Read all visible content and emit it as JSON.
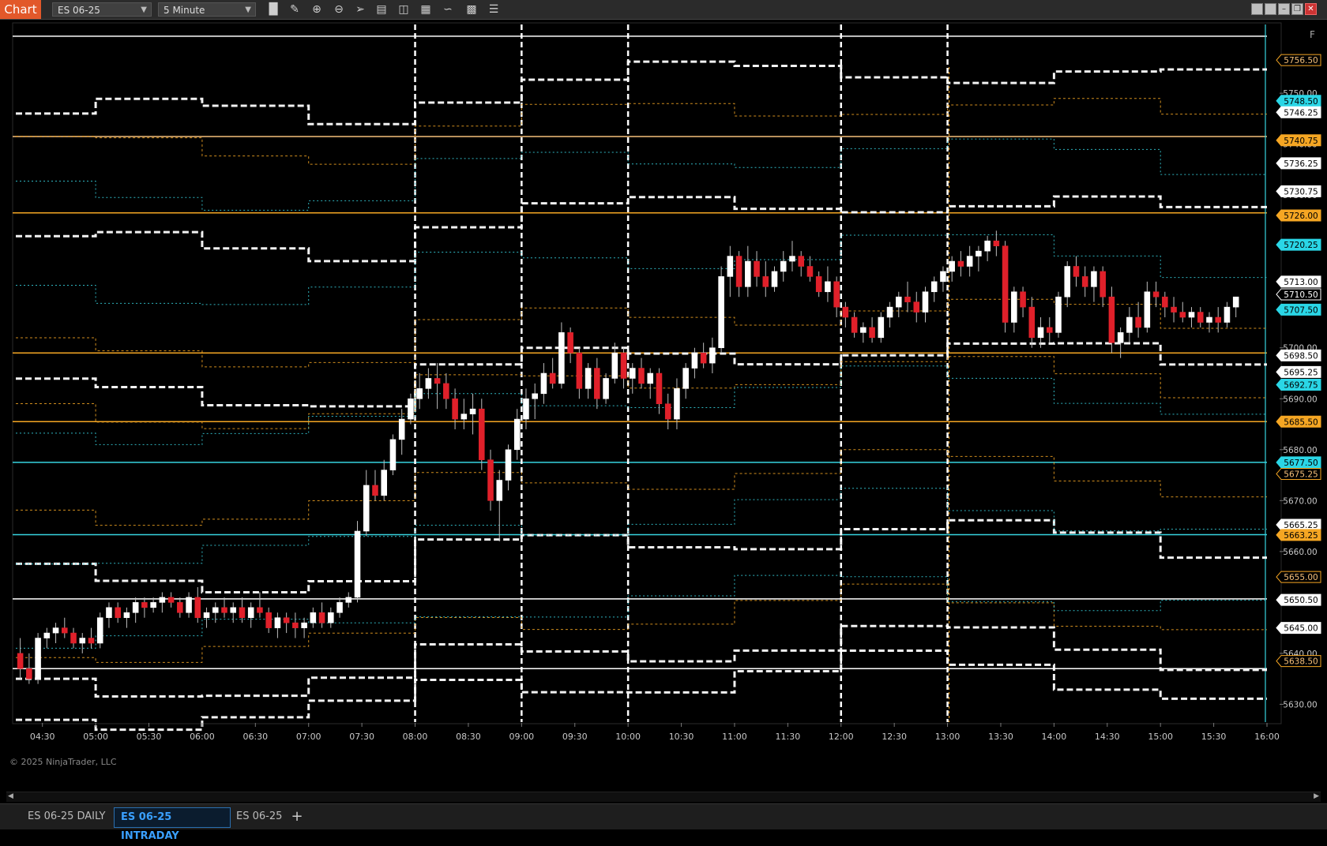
{
  "app": {
    "window_label": "Chart"
  },
  "toolbar": {
    "instrument": "ES 06-25",
    "interval": "5 Minute",
    "icons": [
      "bar-type-icon",
      "draw-tool-icon",
      "zoom-in-icon",
      "zoom-out-icon",
      "pointer-icon",
      "data-box-icon",
      "indicators-icon",
      "strategies-icon",
      "chart-trader-icon",
      "properties-icon",
      "list-icon"
    ]
  },
  "window_controls": [
    "tile-icon",
    "tile-icon",
    "minimize-icon",
    "restore-icon",
    "close-icon"
  ],
  "chart_data": {
    "type": "candlestick",
    "x_ticks": [
      "04:30",
      "05:00",
      "05:30",
      "06:00",
      "06:30",
      "07:00",
      "07:30",
      "08:00",
      "08:30",
      "09:00",
      "09:30",
      "10:00",
      "10:30",
      "11:00",
      "11:30",
      "12:00",
      "12:30",
      "13:00",
      "13:30",
      "14:00",
      "14:30",
      "15:00",
      "15:30",
      "16:00"
    ],
    "y_ticks": [
      5750,
      5740,
      5730,
      5720,
      5710,
      5700,
      5690,
      5680,
      5670,
      5660,
      5650,
      5640,
      5630
    ],
    "y_tick_labels": [
      "5750.00",
      "5740.00",
      "5730.00",
      "5720.00",
      "5710.00",
      "5700.00",
      "5690.00",
      "5680.00",
      "5670.00",
      "5660.00",
      "5650.00",
      "5640.00",
      "5630.00"
    ],
    "ylim": [
      5626.5,
      5763.5
    ],
    "x_start": "04:15",
    "bar_minutes": 5,
    "price_markers": [
      {
        "label": "5756.50",
        "value": 5756.5,
        "kind": "orange-outline"
      },
      {
        "label": "5748.50",
        "value": 5748.5,
        "kind": "cyan"
      },
      {
        "label": "5746.25",
        "value": 5746.25,
        "kind": "white"
      },
      {
        "label": "5740.75",
        "value": 5740.75,
        "kind": "orange"
      },
      {
        "label": "5736.25",
        "value": 5736.25,
        "kind": "white"
      },
      {
        "label": "5730.75",
        "value": 5730.75,
        "kind": "white"
      },
      {
        "label": "5726.00",
        "value": 5726.0,
        "kind": "orange"
      },
      {
        "label": "5720.25",
        "value": 5720.25,
        "kind": "cyan"
      },
      {
        "label": "5713.00",
        "value": 5713.0,
        "kind": "white"
      },
      {
        "label": "5710.50",
        "value": 5710.5,
        "kind": "last"
      },
      {
        "label": "5707.50",
        "value": 5707.5,
        "kind": "cyan"
      },
      {
        "label": "5698.50",
        "value": 5698.5,
        "kind": "white"
      },
      {
        "label": "5695.25",
        "value": 5695.25,
        "kind": "white"
      },
      {
        "label": "5692.75",
        "value": 5692.75,
        "kind": "cyan"
      },
      {
        "label": "5685.50",
        "value": 5685.5,
        "kind": "orange"
      },
      {
        "label": "5677.50",
        "value": 5677.5,
        "kind": "cyan"
      },
      {
        "label": "5675.25",
        "value": 5675.25,
        "kind": "orange-outline"
      },
      {
        "label": "5665.25",
        "value": 5665.25,
        "kind": "white"
      },
      {
        "label": "5663.25",
        "value": 5663.25,
        "kind": "orange"
      },
      {
        "label": "5655.00",
        "value": 5655.0,
        "kind": "orange-outline"
      },
      {
        "label": "5650.50",
        "value": 5650.5,
        "kind": "white"
      },
      {
        "label": "5645.00",
        "value": 5645.0,
        "kind": "white"
      },
      {
        "label": "5638.50",
        "value": 5638.5,
        "kind": "orange-outline"
      }
    ],
    "horizontal_levels": [
      {
        "value": 5741.5,
        "color": "#f5c07a"
      },
      {
        "value": 5726.5,
        "color": "#f5a623"
      },
      {
        "value": 5699.0,
        "color": "#f5a623"
      },
      {
        "value": 5685.5,
        "color": "#f5a623"
      },
      {
        "value": 5677.5,
        "color": "#37d4e0"
      },
      {
        "value": 5663.3,
        "color": "#37d4e0"
      },
      {
        "value": 5650.7,
        "color": "#ffffff"
      },
      {
        "value": 5637.0,
        "color": "#ffffff"
      },
      {
        "value": 5761.2,
        "color": "#ffffff"
      }
    ],
    "candles": [
      [
        5640,
        5643,
        5635,
        5637
      ],
      [
        5637,
        5640,
        5634,
        5635
      ],
      [
        5635,
        5644,
        5634,
        5643
      ],
      [
        5643,
        5645,
        5641,
        5644
      ],
      [
        5644,
        5646,
        5642,
        5645
      ],
      [
        5645,
        5647,
        5643,
        5644
      ],
      [
        5644,
        5645,
        5641,
        5642
      ],
      [
        5642,
        5644,
        5640,
        5643
      ],
      [
        5643,
        5645,
        5641,
        5642
      ],
      [
        5642,
        5648,
        5641,
        5647
      ],
      [
        5647,
        5650,
        5645,
        5649
      ],
      [
        5649,
        5650,
        5646,
        5647
      ],
      [
        5647,
        5649,
        5645,
        5648
      ],
      [
        5648,
        5651,
        5646,
        5650
      ],
      [
        5650,
        5651,
        5647,
        5649
      ],
      [
        5649,
        5651,
        5648,
        5650
      ],
      [
        5650,
        5652,
        5648,
        5651
      ],
      [
        5651,
        5652,
        5649,
        5650
      ],
      [
        5650,
        5651,
        5647,
        5648
      ],
      [
        5648,
        5652,
        5647,
        5651
      ],
      [
        5651,
        5653,
        5646,
        5647
      ],
      [
        5647,
        5649,
        5645,
        5648
      ],
      [
        5648,
        5650,
        5646,
        5649
      ],
      [
        5649,
        5651,
        5647,
        5648
      ],
      [
        5648,
        5650,
        5646,
        5649
      ],
      [
        5649,
        5651,
        5646,
        5647
      ],
      [
        5647,
        5650,
        5645,
        5649
      ],
      [
        5649,
        5652,
        5647,
        5648
      ],
      [
        5648,
        5649,
        5644,
        5645
      ],
      [
        5645,
        5648,
        5643,
        5647
      ],
      [
        5647,
        5648,
        5644,
        5646
      ],
      [
        5646,
        5648,
        5643,
        5645
      ],
      [
        5645,
        5647,
        5643,
        5646
      ],
      [
        5646,
        5649,
        5645,
        5648
      ],
      [
        5648,
        5650,
        5645,
        5646
      ],
      [
        5646,
        5649,
        5645,
        5648
      ],
      [
        5648,
        5651,
        5647,
        5650
      ],
      [
        5650,
        5652,
        5649,
        5651
      ],
      [
        5651,
        5666,
        5650,
        5664
      ],
      [
        5664,
        5676,
        5663,
        5673
      ],
      [
        5673,
        5676,
        5670,
        5671
      ],
      [
        5671,
        5678,
        5670,
        5676
      ],
      [
        5676,
        5683,
        5675,
        5682
      ],
      [
        5682,
        5688,
        5679,
        5686
      ],
      [
        5686,
        5691,
        5685,
        5690
      ],
      [
        5690,
        5695,
        5688,
        5692
      ],
      [
        5692,
        5696,
        5690,
        5694
      ],
      [
        5694,
        5697,
        5688,
        5693
      ],
      [
        5693,
        5695,
        5688,
        5690
      ],
      [
        5690,
        5692,
        5684,
        5686
      ],
      [
        5686,
        5690,
        5684,
        5687
      ],
      [
        5687,
        5691,
        5683,
        5688
      ],
      [
        5688,
        5690,
        5676,
        5678
      ],
      [
        5678,
        5680,
        5668,
        5670
      ],
      [
        5670,
        5676,
        5662,
        5674
      ],
      [
        5674,
        5681,
        5672,
        5680
      ],
      [
        5680,
        5688,
        5678,
        5686
      ],
      [
        5686,
        5692,
        5684,
        5690
      ],
      [
        5690,
        5693,
        5686,
        5691
      ],
      [
        5691,
        5697,
        5689,
        5695
      ],
      [
        5695,
        5698,
        5692,
        5693
      ],
      [
        5693,
        5705,
        5692,
        5703
      ],
      [
        5703,
        5704,
        5697,
        5699
      ],
      [
        5699,
        5700,
        5690,
        5692
      ],
      [
        5692,
        5697,
        5690,
        5696
      ],
      [
        5696,
        5698,
        5688,
        5690
      ],
      [
        5690,
        5695,
        5689,
        5694
      ],
      [
        5694,
        5701,
        5693,
        5699
      ],
      [
        5699,
        5700,
        5692,
        5694
      ],
      [
        5694,
        5697,
        5691,
        5696
      ],
      [
        5696,
        5698,
        5692,
        5693
      ],
      [
        5693,
        5696,
        5690,
        5695
      ],
      [
        5695,
        5696,
        5687,
        5689
      ],
      [
        5689,
        5691,
        5684,
        5686
      ],
      [
        5686,
        5694,
        5684,
        5692
      ],
      [
        5692,
        5697,
        5690,
        5696
      ],
      [
        5696,
        5700,
        5694,
        5699
      ],
      [
        5699,
        5701,
        5696,
        5697
      ],
      [
        5697,
        5702,
        5695,
        5700
      ],
      [
        5700,
        5716,
        5699,
        5714
      ],
      [
        5714,
        5720,
        5710,
        5718
      ],
      [
        5718,
        5719,
        5710,
        5712
      ],
      [
        5712,
        5720,
        5710,
        5717
      ],
      [
        5717,
        5719,
        5712,
        5714
      ],
      [
        5714,
        5717,
        5710,
        5712
      ],
      [
        5712,
        5716,
        5711,
        5715
      ],
      [
        5715,
        5719,
        5713,
        5717
      ],
      [
        5717,
        5721,
        5715,
        5718
      ],
      [
        5718,
        5719,
        5714,
        5716
      ],
      [
        5716,
        5718,
        5713,
        5714
      ],
      [
        5714,
        5715,
        5710,
        5711
      ],
      [
        5711,
        5716,
        5709,
        5713
      ],
      [
        5713,
        5714,
        5706,
        5708
      ],
      [
        5708,
        5709,
        5704,
        5706
      ],
      [
        5706,
        5707,
        5702,
        5703
      ],
      [
        5703,
        5705,
        5701,
        5704
      ],
      [
        5704,
        5706,
        5701,
        5702
      ],
      [
        5702,
        5707,
        5701,
        5706
      ],
      [
        5706,
        5709,
        5704,
        5708
      ],
      [
        5708,
        5711,
        5706,
        5710
      ],
      [
        5710,
        5713,
        5707,
        5709
      ],
      [
        5709,
        5711,
        5705,
        5707
      ],
      [
        5707,
        5712,
        5705,
        5711
      ],
      [
        5711,
        5714,
        5709,
        5713
      ],
      [
        5713,
        5716,
        5711,
        5715
      ],
      [
        5715,
        5718,
        5713,
        5717
      ],
      [
        5717,
        5719,
        5714,
        5716
      ],
      [
        5716,
        5720,
        5714,
        5718
      ],
      [
        5718,
        5720,
        5715,
        5719
      ],
      [
        5719,
        5722,
        5717,
        5721
      ],
      [
        5721,
        5723,
        5718,
        5720
      ],
      [
        5720,
        5721,
        5703,
        5705
      ],
      [
        5705,
        5712,
        5703,
        5711
      ],
      [
        5711,
        5712,
        5706,
        5708
      ],
      [
        5708,
        5710,
        5700,
        5702
      ],
      [
        5702,
        5706,
        5700,
        5704
      ],
      [
        5704,
        5706,
        5701,
        5703
      ],
      [
        5703,
        5711,
        5702,
        5710
      ],
      [
        5710,
        5717,
        5708,
        5716
      ],
      [
        5716,
        5718,
        5712,
        5714
      ],
      [
        5714,
        5716,
        5710,
        5712
      ],
      [
        5712,
        5716,
        5709,
        5715
      ],
      [
        5715,
        5716,
        5708,
        5710
      ],
      [
        5710,
        5712,
        5699,
        5701
      ],
      [
        5701,
        5704,
        5698,
        5703
      ],
      [
        5703,
        5708,
        5701,
        5706
      ],
      [
        5706,
        5709,
        5702,
        5704
      ],
      [
        5704,
        5713,
        5703,
        5711
      ],
      [
        5711,
        5713,
        5708,
        5710
      ],
      [
        5710,
        5711,
        5706,
        5708
      ],
      [
        5708,
        5710,
        5705,
        5707
      ],
      [
        5707,
        5709,
        5705,
        5706
      ],
      [
        5706,
        5708,
        5704,
        5707
      ],
      [
        5707,
        5708,
        5704,
        5705
      ],
      [
        5705,
        5707,
        5703,
        5706
      ],
      [
        5706,
        5708,
        5703,
        5705
      ],
      [
        5705,
        5709,
        5704,
        5708
      ],
      [
        5708,
        5710,
        5706,
        5710
      ]
    ]
  },
  "status": {
    "copyright": "© 2025 NinjaTrader, LLC"
  },
  "panel": {
    "f_label": "F"
  },
  "tabs": [
    {
      "label": "ES 06-25 DAILY"
    },
    {
      "label": "ES 06-25 INTRADAY"
    },
    {
      "label": "ES 06-25"
    }
  ],
  "add_tab_label": "+"
}
